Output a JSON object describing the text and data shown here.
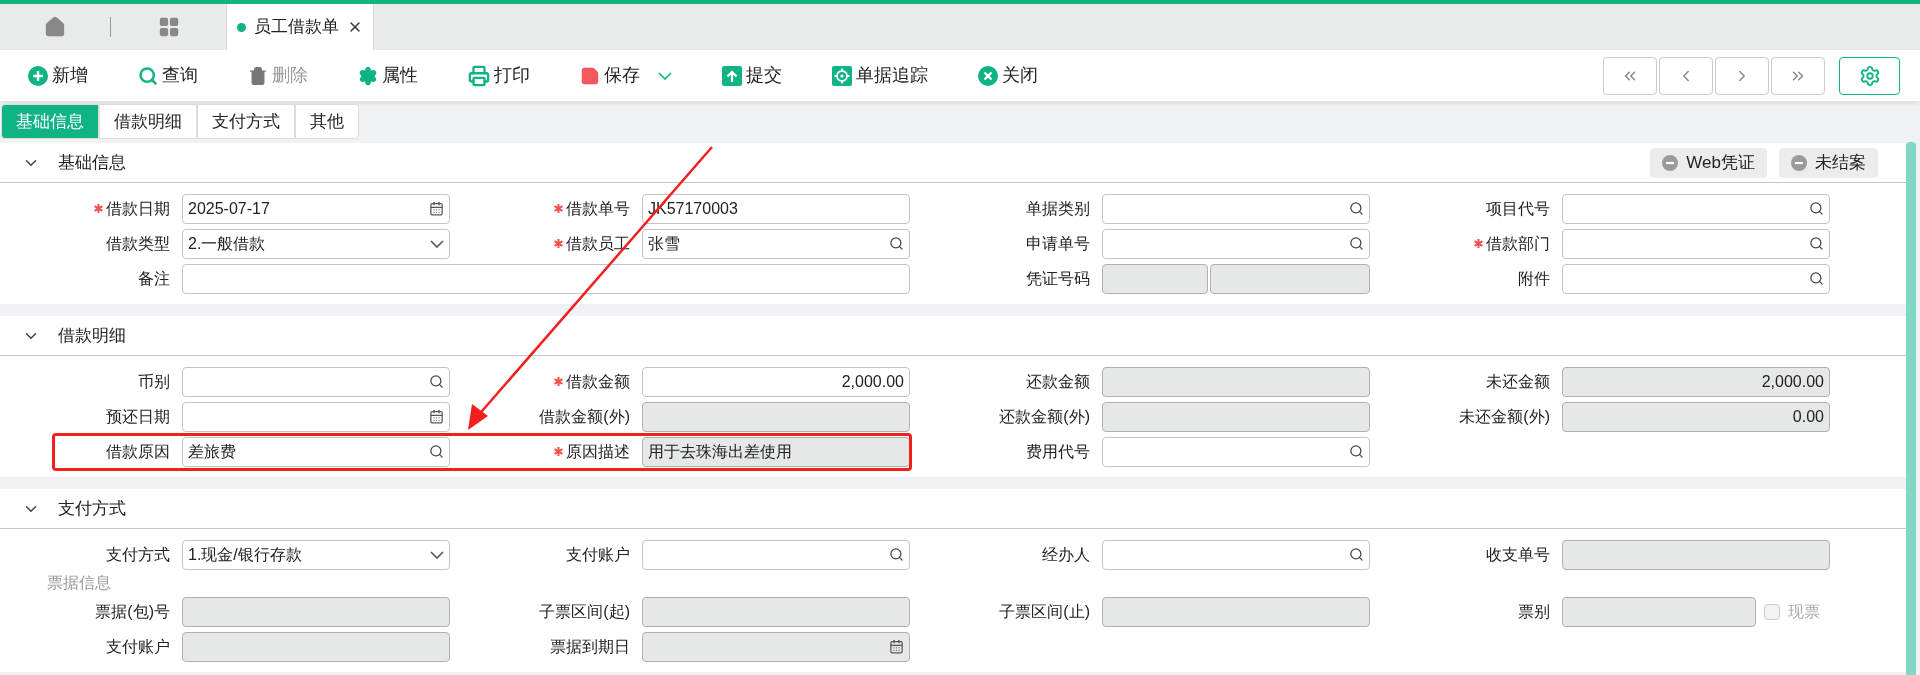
{
  "doc_tabs": [
    {
      "label": "员工借款单",
      "selected": true
    }
  ],
  "toolbar": [
    {
      "label": "新增",
      "disabled": false
    },
    {
      "label": "查询",
      "disabled": false
    },
    {
      "label": "删除",
      "disabled": true
    },
    {
      "label": "属性",
      "disabled": false
    },
    {
      "label": "打印",
      "disabled": false
    },
    {
      "label": "保存",
      "disabled": false,
      "has_menu": true
    },
    {
      "label": "提交",
      "disabled": false
    },
    {
      "label": "单据追踪",
      "disabled": false
    },
    {
      "label": "关闭",
      "disabled": false
    }
  ],
  "tabs": [
    {
      "label": "基础信息",
      "selected": true
    },
    {
      "label": "借款明细",
      "selected": false
    },
    {
      "label": "支付方式",
      "selected": false
    },
    {
      "label": "其他",
      "selected": false
    }
  ],
  "sections": [
    {
      "title": "基础信息",
      "expanded": true,
      "actions": [
        "Web凭证",
        "未结案"
      ],
      "rows": [
        {
          "kind": "fields",
          "highlighted": false,
          "cells": [
            {
              "label": "借款日期",
              "required": true,
              "kind": "date",
              "disabled": false,
              "value": "2025-07-17"
            },
            {
              "label": "借款单号",
              "required": true,
              "kind": "text",
              "disabled": false,
              "value": "JK57170003"
            },
            {
              "label": "单据类别",
              "required": false,
              "kind": "lookup",
              "disabled": false
            },
            {
              "label": "项目代号",
              "required": false,
              "kind": "lookup",
              "disabled": false
            }
          ]
        },
        {
          "kind": "fields",
          "highlighted": false,
          "cells": [
            {
              "label": "借款类型",
              "required": false,
              "kind": "select",
              "disabled": false,
              "value": "2.一般借款"
            },
            {
              "label": "借款员工",
              "required": true,
              "kind": "lookup",
              "disabled": false,
              "value": "张雪"
            },
            {
              "label": "申请单号",
              "required": false,
              "kind": "lookup",
              "disabled": false
            },
            {
              "label": "借款部门",
              "required": true,
              "kind": "lookup",
              "disabled": false
            }
          ]
        },
        {
          "kind": "fields",
          "highlighted": false,
          "cells": [
            {
              "label": "备注",
              "required": false,
              "kind": "text",
              "disabled": false,
              "wide": true
            },
            null,
            {
              "label": "凭证号码",
              "required": false,
              "kind": "split",
              "disabled": true
            },
            {
              "label": "附件",
              "required": false,
              "kind": "lookup",
              "disabled": false
            }
          ]
        }
      ]
    },
    {
      "title": "借款明细",
      "expanded": true,
      "rows": [
        {
          "kind": "fields",
          "highlighted": false,
          "cells": [
            {
              "label": "币别",
              "required": false,
              "kind": "lookup",
              "disabled": false
            },
            {
              "label": "借款金额",
              "required": true,
              "kind": "amount",
              "disabled": false,
              "value": "2,000.00"
            },
            {
              "label": "还款金额",
              "required": false,
              "kind": "amount",
              "disabled": true
            },
            {
              "label": "未还金额",
              "required": false,
              "kind": "amount",
              "disabled": true,
              "value": "2,000.00"
            }
          ]
        },
        {
          "kind": "fields",
          "highlighted": false,
          "cells": [
            {
              "label": "预还日期",
              "required": false,
              "kind": "date",
              "disabled": false
            },
            {
              "label": "借款金额(外)",
              "required": false,
              "kind": "amount",
              "disabled": true
            },
            {
              "label": "还款金额(外)",
              "required": false,
              "kind": "amount",
              "disabled": true
            },
            {
              "label": "未还金额(外)",
              "required": false,
              "kind": "amount",
              "disabled": true,
              "value": "0.00"
            }
          ]
        },
        {
          "kind": "fields",
          "highlighted": true,
          "cells": [
            {
              "label": "借款原因",
              "required": false,
              "kind": "lookup",
              "disabled": false,
              "value": "差旅费"
            },
            {
              "label": "原因描述",
              "required": true,
              "kind": "text",
              "disabled": true,
              "value": "用于去珠海出差使用"
            },
            {
              "label": "费用代号",
              "required": false,
              "kind": "lookup",
              "disabled": false
            },
            null
          ]
        }
      ]
    },
    {
      "title": "支付方式",
      "expanded": true,
      "rows": [
        {
          "kind": "fields",
          "highlighted": false,
          "cells": [
            {
              "label": "支付方式",
              "required": false,
              "kind": "select",
              "disabled": false,
              "value": "1.现金/银行存款"
            },
            {
              "label": "支付账户",
              "required": false,
              "kind": "lookup",
              "disabled": false
            },
            {
              "label": "经办人",
              "required": false,
              "kind": "lookup",
              "disabled": false
            },
            {
              "label": "收支单号",
              "required": false,
              "kind": "text",
              "disabled": true
            }
          ]
        },
        {
          "kind": "subheading",
          "text": "票据信息"
        },
        {
          "kind": "fields",
          "highlighted": false,
          "cells": [
            {
              "label": "票据(包)号",
              "required": false,
              "kind": "text",
              "disabled": true
            },
            {
              "label": "子票区间(起)",
              "required": false,
              "kind": "text",
              "disabled": true
            },
            {
              "label": "子票区间(止)",
              "required": false,
              "kind": "text",
              "disabled": true
            },
            {
              "label": "票别",
              "required": false,
              "kind": "text",
              "disabled": true,
              "narrow": true,
              "checkbox": {
                "label": "现票",
                "checked": false,
                "disabled": true
              }
            }
          ]
        },
        {
          "kind": "fields",
          "highlighted": false,
          "cells": [
            {
              "label": "支付账户",
              "required": false,
              "kind": "text",
              "disabled": true
            },
            {
              "label": "票据到期日",
              "required": false,
              "kind": "date",
              "disabled": true
            },
            null,
            null
          ]
        }
      ]
    }
  ]
}
